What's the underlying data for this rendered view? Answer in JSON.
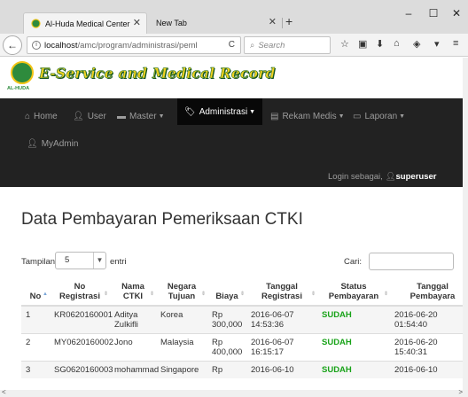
{
  "browser": {
    "tabs": [
      {
        "title": "Al-Huda Medical Center",
        "active": true
      },
      {
        "title": "New Tab",
        "active": false
      }
    ],
    "url_host": "localhost",
    "url_path": "/amc/program/administrasi/peml",
    "search_placeholder": "Search",
    "window_controls": {
      "minimize": "–",
      "maximize": "☐",
      "close": "✕"
    }
  },
  "site": {
    "title": "E-Service and Medical Record",
    "logo_caption": "AL-HUDA"
  },
  "menu": [
    {
      "label": "Home",
      "icon": "home-icon",
      "caret": false
    },
    {
      "label": "User",
      "icon": "user-icon",
      "caret": false
    },
    {
      "label": "Master",
      "icon": "hdd-icon",
      "caret": true
    },
    {
      "label": "Administrasi",
      "icon": "tag-icon",
      "caret": true,
      "active": true
    },
    {
      "label": "Rekam Medis",
      "icon": "list-icon",
      "caret": true
    },
    {
      "label": "Laporan",
      "icon": "card-icon",
      "caret": true
    },
    {
      "label": "MyAdmin",
      "icon": "user-icon",
      "caret": false
    }
  ],
  "login": {
    "prefix": "Login sebagai,",
    "user": "superuser"
  },
  "page": {
    "heading": "Data Pembayaran Pemeriksaan CTKI",
    "length_label": "Tampilan",
    "length_value": "5",
    "length_suffix": "entri",
    "search_label": "Cari:"
  },
  "table": {
    "columns": [
      "No",
      "No Registrasi",
      "Nama CTKI",
      "Negara Tujuan",
      "Biaya",
      "Tanggal Registrasi",
      "Status Pembayaran",
      "Tanggal Pembayara"
    ],
    "rows": [
      [
        "1",
        "KR0620160001",
        "Aditya Zulkifli",
        "Korea",
        "Rp 300,000",
        "2016-06-07 14:53:36",
        "SUDAH",
        "2016-06-20 01:54:40"
      ],
      [
        "2",
        "MY0620160002",
        "Jono",
        "Malaysia",
        "Rp 400,000",
        "2016-06-07 16:15:17",
        "SUDAH",
        "2016-06-20 15:40:31"
      ],
      [
        "3",
        "SG0620160003",
        "mohammad",
        "Singapore",
        "Rp",
        "2016-06-10",
        "SUDAH",
        "2016-06-10"
      ]
    ]
  },
  "colors": {
    "nav_bg": "#222222",
    "status_ok": "#19a319",
    "logo_green": "#2e8b3d",
    "title_yellow": "#f0d020"
  }
}
